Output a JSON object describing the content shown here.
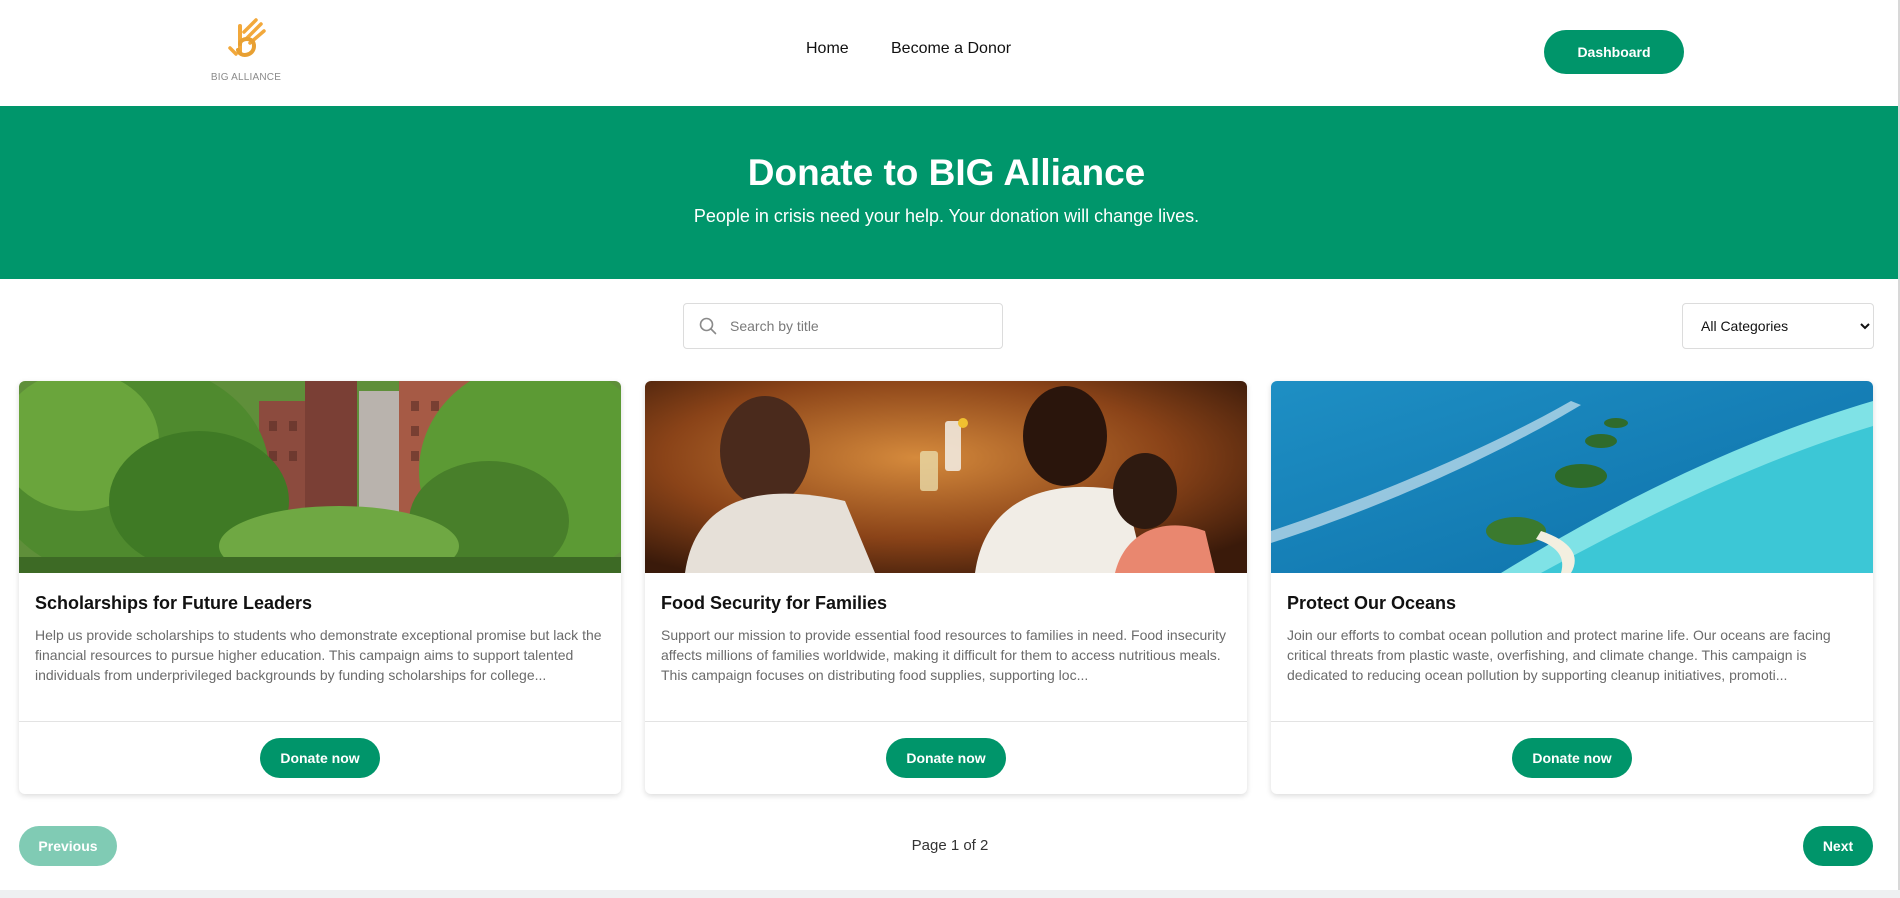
{
  "header": {
    "logo_text": "BIG ALLIANCE",
    "nav": {
      "home": "Home",
      "become_donor": "Become a Donor"
    },
    "dashboard_label": "Dashboard"
  },
  "hero": {
    "title": "Donate to BIG Alliance",
    "subtitle": "People in crisis need your help. Your donation will change lives."
  },
  "filters": {
    "search_placeholder": "Search by title",
    "category_selected": "All Categories"
  },
  "campaigns": [
    {
      "title": "Scholarships for Future Leaders",
      "description": "Help us provide scholarships to students who demonstrate exceptional promise but lack the financial resources to pursue higher education. This campaign aims to support talented individuals from underprivileged backgrounds by funding scholarships for college...",
      "button_label": "Donate now",
      "image": "city-park-trees-buildings-photo"
    },
    {
      "title": "Food Security for Families",
      "description": "Support our mission to provide essential food resources to families in need. Food insecurity affects millions of families worldwide, making it difficult for them to access nutritious meals. This campaign focuses on distributing food supplies, supporting loc...",
      "button_label": "Donate now",
      "image": "family-toasting-drinks-photo"
    },
    {
      "title": "Protect Our Oceans",
      "description": "Join our efforts to combat ocean pollution and protect marine life. Our oceans are facing critical threats from plastic waste, overfishing, and climate change. This campaign is dedicated to reducing ocean pollution by supporting cleanup initiatives, promoti...",
      "button_label": "Donate now",
      "image": "aerial-ocean-islands-photo"
    }
  ],
  "pagination": {
    "previous_label": "Previous",
    "page_info": "Page 1 of 2",
    "next_label": "Next"
  },
  "colors": {
    "brand_green": "#00956a",
    "brand_green_disabled": "#80cbb4",
    "logo_orange": "#f2a83b"
  }
}
